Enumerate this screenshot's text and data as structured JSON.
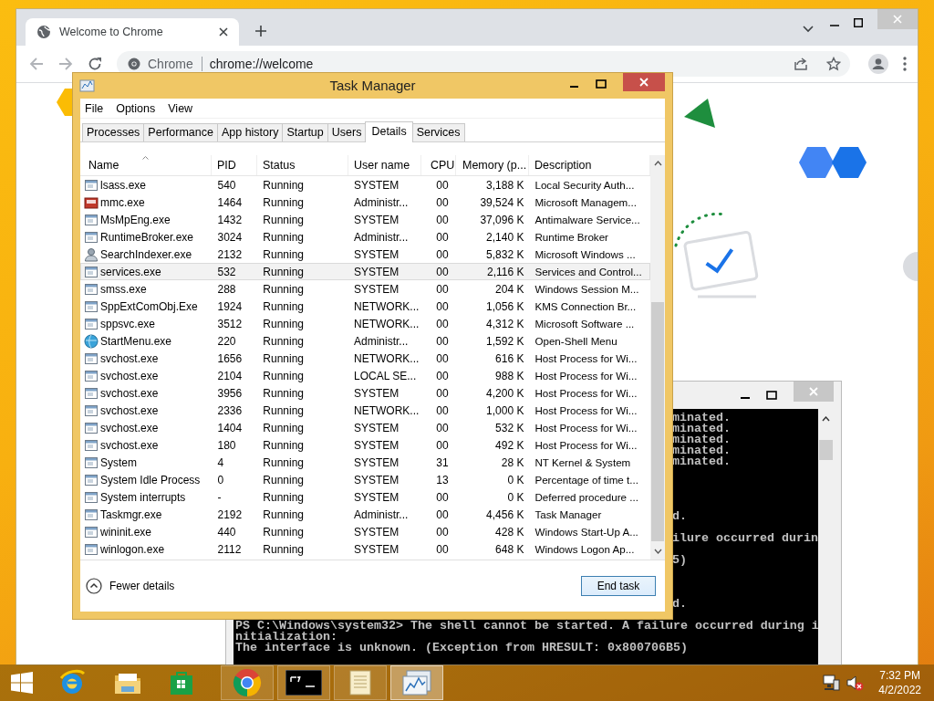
{
  "browser": {
    "tab": {
      "title": "Welcome to Chrome"
    },
    "omnibox": {
      "site": "Chrome",
      "url": "chrome://welcome"
    }
  },
  "console": {
    "clipped_lines": [
      "minated.",
      "minated.",
      "minated.",
      "minated.",
      "minated.",
      "d.",
      "ilure occurred durin",
      "5)",
      "d."
    ],
    "lines": [
      "PS C:\\Windows\\system32> The shell cannot be started. A failure occurred during i",
      "nitialization:",
      "The interface is unknown. (Exception from HRESULT: 0x800706B5)"
    ]
  },
  "task_manager": {
    "title": "Task Manager",
    "menu": [
      "File",
      "Options",
      "View"
    ],
    "tabs": [
      {
        "label": "Processes",
        "selected": false
      },
      {
        "label": "Performance",
        "selected": false
      },
      {
        "label": "App history",
        "selected": false
      },
      {
        "label": "Startup",
        "selected": false
      },
      {
        "label": "Users",
        "selected": false
      },
      {
        "label": "Details",
        "selected": true
      },
      {
        "label": "Services",
        "selected": false
      }
    ],
    "columns": [
      {
        "label": "Name",
        "sorted": true
      },
      {
        "label": "PID",
        "sorted": false
      },
      {
        "label": "Status",
        "sorted": false
      },
      {
        "label": "User name",
        "sorted": false
      },
      {
        "label": "CPU",
        "sorted": false
      },
      {
        "label": "Memory (p...",
        "sorted": false
      },
      {
        "label": "Description",
        "sorted": false
      }
    ],
    "rows": [
      {
        "kind": "app",
        "name": "lsass.exe",
        "pid": "540",
        "status": "Running",
        "user": "SYSTEM",
        "cpu": "00",
        "memory": "3,188 K",
        "description": "Local Security Auth...",
        "selected": false
      },
      {
        "kind": "mmc",
        "name": "mmc.exe",
        "pid": "1464",
        "status": "Running",
        "user": "Administr...",
        "cpu": "00",
        "memory": "39,524 K",
        "description": "Microsoft Managem...",
        "selected": false
      },
      {
        "kind": "app",
        "name": "MsMpEng.exe",
        "pid": "1432",
        "status": "Running",
        "user": "SYSTEM",
        "cpu": "00",
        "memory": "37,096 K",
        "description": "Antimalware Service...",
        "selected": false
      },
      {
        "kind": "app",
        "name": "RuntimeBroker.exe",
        "pid": "3024",
        "status": "Running",
        "user": "Administr...",
        "cpu": "00",
        "memory": "2,140 K",
        "description": "Runtime Broker",
        "selected": false
      },
      {
        "kind": "indexer",
        "name": "SearchIndexer.exe",
        "pid": "2132",
        "status": "Running",
        "user": "SYSTEM",
        "cpu": "00",
        "memory": "5,832 K",
        "description": "Microsoft Windows ...",
        "selected": false
      },
      {
        "kind": "app",
        "name": "services.exe",
        "pid": "532",
        "status": "Running",
        "user": "SYSTEM",
        "cpu": "00",
        "memory": "2,116 K",
        "description": "Services and Control...",
        "selected": true
      },
      {
        "kind": "app",
        "name": "smss.exe",
        "pid": "288",
        "status": "Running",
        "user": "SYSTEM",
        "cpu": "00",
        "memory": "204 K",
        "description": "Windows Session M...",
        "selected": false
      },
      {
        "kind": "app",
        "name": "SppExtComObj.Exe",
        "pid": "1924",
        "status": "Running",
        "user": "NETWORK...",
        "cpu": "00",
        "memory": "1,056 K",
        "description": "KMS Connection Br...",
        "selected": false
      },
      {
        "kind": "app",
        "name": "sppsvc.exe",
        "pid": "3512",
        "status": "Running",
        "user": "NETWORK...",
        "cpu": "00",
        "memory": "4,312 K",
        "description": "Microsoft Software ...",
        "selected": false
      },
      {
        "kind": "shell",
        "name": "StartMenu.exe",
        "pid": "220",
        "status": "Running",
        "user": "Administr...",
        "cpu": "00",
        "memory": "1,592 K",
        "description": "Open-Shell Menu",
        "selected": false
      },
      {
        "kind": "app",
        "name": "svchost.exe",
        "pid": "1656",
        "status": "Running",
        "user": "NETWORK...",
        "cpu": "00",
        "memory": "616 K",
        "description": "Host Process for Wi...",
        "selected": false
      },
      {
        "kind": "app",
        "name": "svchost.exe",
        "pid": "2104",
        "status": "Running",
        "user": "LOCAL SE...",
        "cpu": "00",
        "memory": "988 K",
        "description": "Host Process for Wi...",
        "selected": false
      },
      {
        "kind": "app",
        "name": "svchost.exe",
        "pid": "3956",
        "status": "Running",
        "user": "SYSTEM",
        "cpu": "00",
        "memory": "4,200 K",
        "description": "Host Process for Wi...",
        "selected": false
      },
      {
        "kind": "app",
        "name": "svchost.exe",
        "pid": "2336",
        "status": "Running",
        "user": "NETWORK...",
        "cpu": "00",
        "memory": "1,000 K",
        "description": "Host Process for Wi...",
        "selected": false
      },
      {
        "kind": "app",
        "name": "svchost.exe",
        "pid": "1404",
        "status": "Running",
        "user": "SYSTEM",
        "cpu": "00",
        "memory": "532 K",
        "description": "Host Process for Wi...",
        "selected": false
      },
      {
        "kind": "app",
        "name": "svchost.exe",
        "pid": "180",
        "status": "Running",
        "user": "SYSTEM",
        "cpu": "00",
        "memory": "492 K",
        "description": "Host Process for Wi...",
        "selected": false
      },
      {
        "kind": "app",
        "name": "System",
        "pid": "4",
        "status": "Running",
        "user": "SYSTEM",
        "cpu": "31",
        "memory": "28 K",
        "description": "NT Kernel & System",
        "selected": false
      },
      {
        "kind": "app",
        "name": "System Idle Process",
        "pid": "0",
        "status": "Running",
        "user": "SYSTEM",
        "cpu": "13",
        "memory": "0 K",
        "description": "Percentage of time t...",
        "selected": false
      },
      {
        "kind": "app",
        "name": "System interrupts",
        "pid": "-",
        "status": "Running",
        "user": "SYSTEM",
        "cpu": "00",
        "memory": "0 K",
        "description": "Deferred procedure ...",
        "selected": false
      },
      {
        "kind": "app",
        "name": "Taskmgr.exe",
        "pid": "2192",
        "status": "Running",
        "user": "Administr...",
        "cpu": "00",
        "memory": "4,456 K",
        "description": "Task Manager",
        "selected": false
      },
      {
        "kind": "app",
        "name": "wininit.exe",
        "pid": "440",
        "status": "Running",
        "user": "SYSTEM",
        "cpu": "00",
        "memory": "428 K",
        "description": "Windows Start-Up A...",
        "selected": false
      },
      {
        "kind": "app",
        "name": "winlogon.exe",
        "pid": "2112",
        "status": "Running",
        "user": "SYSTEM",
        "cpu": "00",
        "memory": "648 K",
        "description": "Windows Logon Ap...",
        "selected": false
      }
    ],
    "footer": {
      "toggle": "Fewer details",
      "button": "End task"
    }
  },
  "taskbar": {
    "windows": [
      {
        "kind": "chrome",
        "active": false
      },
      {
        "kind": "console",
        "active": false
      },
      {
        "kind": "notes",
        "active": false
      },
      {
        "kind": "taskmgr",
        "active": true
      }
    ],
    "time": "7:32 PM",
    "date": "4/2/2022"
  }
}
